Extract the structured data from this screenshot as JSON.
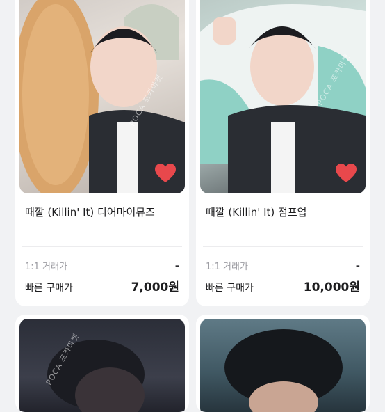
{
  "products": [
    {
      "title": "때깔 (Killin' It) 디어마이뮤즈",
      "trade_label": "1:1 거래가",
      "trade_value": "-",
      "buy_label": "빠른 구매가",
      "buy_value": "7,000원",
      "liked": true
    },
    {
      "title": "때깔 (Killin' It) 점프업",
      "trade_label": "1:1 거래가",
      "trade_value": "-",
      "buy_label": "빠른 구매가",
      "buy_value": "10,000원",
      "liked": true
    }
  ],
  "watermark": "POCA 포카마켓",
  "colors": {
    "heart": "#e8484c",
    "background": "#f1f2f4"
  }
}
